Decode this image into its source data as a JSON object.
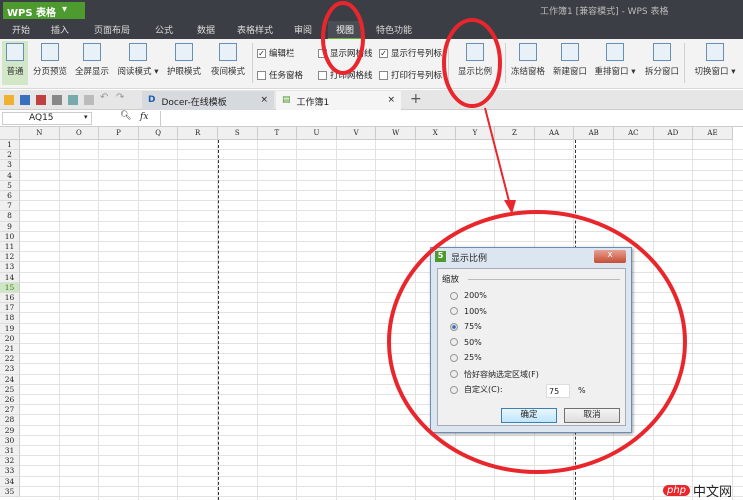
{
  "app": {
    "button_label": "WPS 表格",
    "window_title": "工作簿1 [兼容模式] - WPS 表格"
  },
  "menu": [
    "开始",
    "插入",
    "页面布局",
    "公式",
    "数据",
    "表格样式",
    "审阅",
    "视图",
    "特色功能"
  ],
  "menu_active": "视图",
  "ribbon": {
    "buttons": [
      "普通",
      "分页预览",
      "全屏显示",
      "阅读模式 ▾",
      "护眼模式",
      "夜间模式"
    ],
    "checks": [
      {
        "label": "编辑栏",
        "checked": true
      },
      {
        "label": "任务窗格",
        "checked": false
      },
      {
        "label": "显示网格线",
        "checked": false
      },
      {
        "label": "打印网格线",
        "checked": false
      },
      {
        "label": "显示行号列标",
        "checked": true
      },
      {
        "label": "打印行号列标",
        "checked": false
      }
    ],
    "buttons2": [
      "显示比例",
      "冻结窗格",
      "新建窗口",
      "重排窗口 ▾",
      "拆分窗口",
      "切换窗口 ▾"
    ]
  },
  "tabs": [
    {
      "label": "Docer-在线模板"
    },
    {
      "label": "工作簿1"
    }
  ],
  "formula": {
    "name_box": "AQ15",
    "fx": "fx"
  },
  "grid": {
    "columns": [
      "N",
      "O",
      "P",
      "Q",
      "R",
      "S",
      "T",
      "U",
      "V",
      "W",
      "X",
      "Y",
      "Z",
      "AA",
      "AB",
      "AC",
      "AD",
      "AE"
    ],
    "rows": 35,
    "selected_row": 15
  },
  "dialog": {
    "title": "显示比例",
    "group": "缩放",
    "options": [
      "200%",
      "100%",
      "75%",
      "50%",
      "25%",
      "恰好容纳选定区域(F)",
      "自定义(C):"
    ],
    "selected": "75%",
    "custom_value": "75",
    "unit": "%",
    "ok": "确定",
    "cancel": "取消",
    "close": "x"
  },
  "watermark": "php中文网",
  "colors": {
    "accent": "#4d9a2f",
    "annotation": "#e8262b",
    "titlebar": "#3b3e44"
  }
}
